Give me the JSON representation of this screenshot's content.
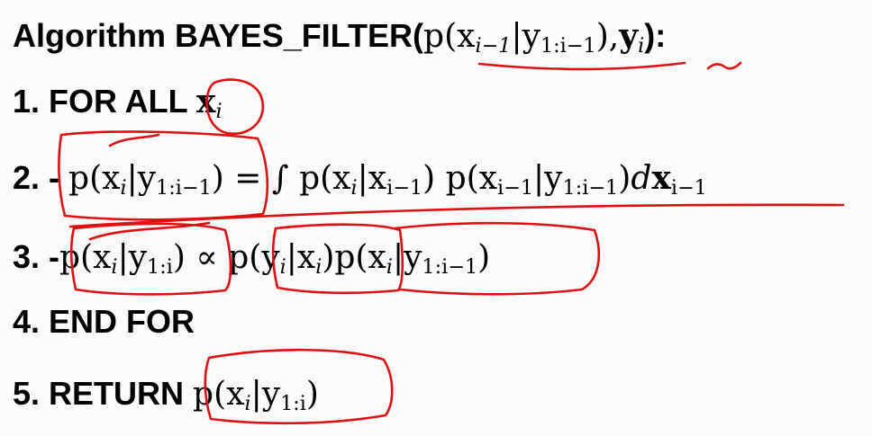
{
  "title": {
    "label": "Algorithm BAYES_FILTER(",
    "arg1": "p(x",
    "arg1_sub": "i−1",
    "arg1_bar": "|y",
    "arg1_bar_sub": "1:i−1",
    "arg1_close": "),",
    "arg2": "y",
    "arg2_sub": "i",
    "close": "):"
  },
  "line1": {
    "label": "1. FOR ALL",
    "var": "x",
    "var_sub": "i"
  },
  "line2": {
    "label": "2. -",
    "lhs": "p(x",
    "lhs_sub": "i",
    "lhs_bar": "|y",
    "lhs_bar_sub": "1:i−1",
    "lhs_close": ")",
    "eq": " = ∫ ",
    "t1": "p(x",
    "t1_sub": "i",
    "t1_bar": "|x",
    "t1_bar_sub": "i−1",
    "t1_close": ") ",
    "t2": "p(x",
    "t2_sub": "i−1",
    "t2_bar": "|y",
    "t2_bar_sub": "1:i−1",
    "t2_close": ")",
    "d": "d",
    "dx": "x",
    "dx_sub": "i−1"
  },
  "line3": {
    "label": "3. -",
    "lhs": "p(x",
    "lhs_sub": "i",
    "lhs_bar": "|y",
    "lhs_bar_sub": "1:i",
    "lhs_close": ")",
    "prop": " ∝ ",
    "t1": "p(y",
    "t1_sub": "i",
    "t1_bar": "|x",
    "t1_bar_sub": "i",
    "t1_close": ")",
    "t2": "p(x",
    "t2_sub": "i",
    "t2_bar": "|y",
    "t2_bar_sub": "1:i−1",
    "t2_close": ")"
  },
  "line4": {
    "label": "4. END FOR"
  },
  "line5": {
    "label": "5. RETURN",
    "expr": "p(x",
    "expr_sub": "i",
    "expr_bar": "|y",
    "expr_bar_sub": "1:i",
    "expr_close": ")"
  },
  "annotation_color": "#e01010"
}
